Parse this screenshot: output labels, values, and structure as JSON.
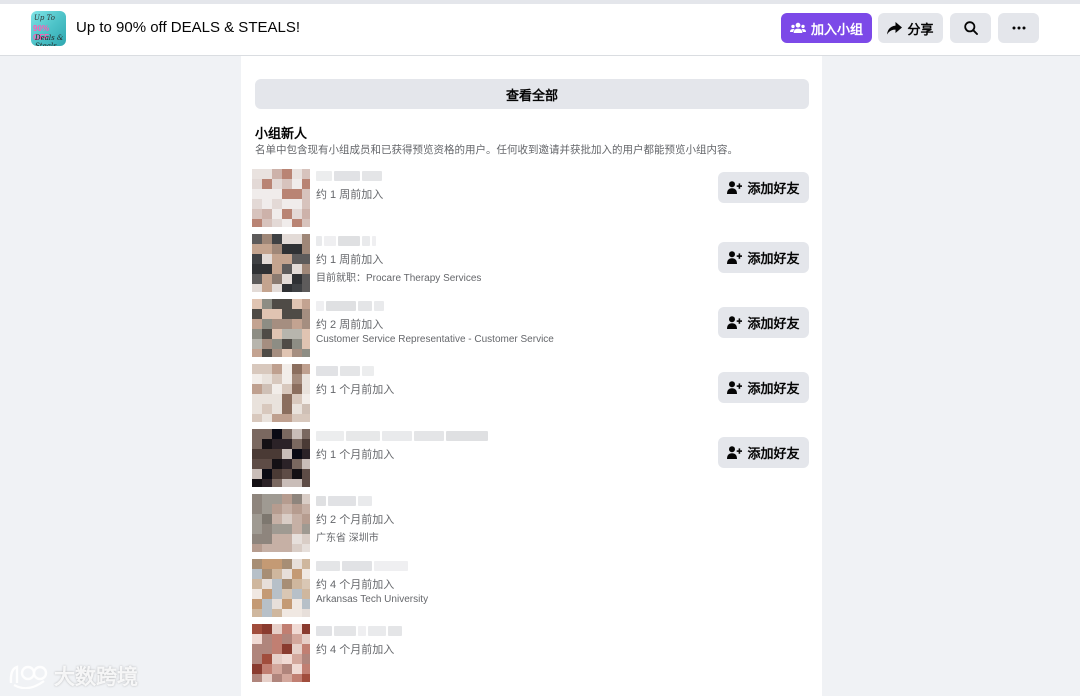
{
  "header": {
    "group_name": "Up to 90% off DEALS & STEALS!",
    "logo_text": [
      "Up To",
      "90% OFF",
      "Deals & Steals"
    ],
    "join_label": "加入小组",
    "share_label": "分享"
  },
  "panel": {
    "view_all_label": "查看全部",
    "section_title": "小组新人",
    "section_desc": "名单中包含现有小组成员和已获得预览资格的用户。任何收到邀请并获批加入的用户都能预览小组内容。",
    "add_friend_label": "添加好友",
    "members": [
      {
        "joined": "约 1 周前加入",
        "extra": "",
        "has_button": true
      },
      {
        "joined": "约 1 周前加入",
        "extra": "目前就职：Procare Therapy Services",
        "has_button": true
      },
      {
        "joined": "约 2 周前加入",
        "extra": "Customer Service Representative - Customer Service",
        "has_button": true
      },
      {
        "joined": "约 1 个月前加入",
        "extra": "",
        "has_button": true
      },
      {
        "joined": "约 1 个月前加入",
        "extra": "",
        "has_button": true
      },
      {
        "joined": "约 2 个月前加入",
        "extra": "广东省 深圳市",
        "has_button": false
      },
      {
        "joined": "约 4 个月前加入",
        "extra": "Arkansas Tech University",
        "has_button": false
      },
      {
        "joined": "约 4 个月前加入",
        "extra": "",
        "has_button": false
      }
    ]
  },
  "watermark": {
    "text": "大数跨境"
  },
  "colors": {
    "accent": "#7c49e8",
    "button_gray": "#e4e6eb",
    "secondary_text": "#65676b"
  }
}
